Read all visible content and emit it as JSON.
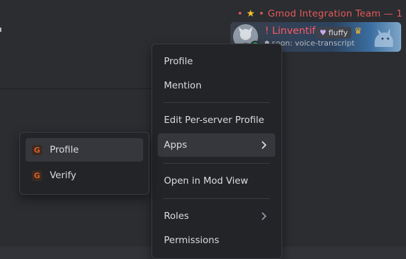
{
  "member_list": {
    "role_header": {
      "prefix": "•",
      "star_icon": "star-icon",
      "separator": "•",
      "title": "Gmod Integration Team — 1"
    },
    "member": {
      "name": "! Linventif",
      "tag_icon": "heart-icon",
      "tag": "fluffy",
      "crown_icon": "crown-icon",
      "status_icon": "mic-icon",
      "status": "soon: voice-transcript",
      "status_color": "#23a55a",
      "name_color": "#ff5a5f"
    }
  },
  "context_menu": {
    "items": [
      {
        "label": "Profile"
      },
      {
        "label": "Mention"
      },
      {
        "label": "Edit Per-server Profile"
      },
      {
        "label": "Apps",
        "has_submenu": true
      },
      {
        "label": "Open in Mod View"
      },
      {
        "label": "Roles",
        "has_submenu": true
      },
      {
        "label": "Permissions"
      }
    ]
  },
  "apps_submenu": {
    "items": [
      {
        "label": "Profile",
        "icon": "gmod-app-icon",
        "icon_letter": "G"
      },
      {
        "label": "Verify",
        "icon": "gmod-app-icon",
        "icon_letter": "G"
      }
    ]
  },
  "colors": {
    "background": "#313338",
    "menu_bg": "#232428",
    "hover_bg": "#35373c",
    "role_color": "#e45a5a",
    "accent_star": "#f4c12e"
  }
}
